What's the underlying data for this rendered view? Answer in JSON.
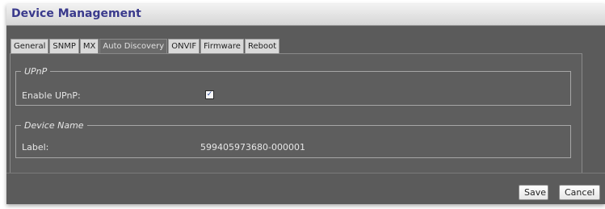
{
  "window": {
    "title": "Device Management"
  },
  "tabs": [
    {
      "label": "General",
      "active": false
    },
    {
      "label": "SNMP",
      "active": false
    },
    {
      "label": "MX",
      "active": false
    },
    {
      "label": "Auto Discovery",
      "active": true
    },
    {
      "label": "ONVIF",
      "active": false
    },
    {
      "label": "Firmware",
      "active": false
    },
    {
      "label": "Reboot",
      "active": false
    }
  ],
  "upnp": {
    "legend": "UPnP",
    "enable_label": "Enable UPnP:",
    "enabled": true,
    "check_glyph": "✓"
  },
  "device_name": {
    "legend": "Device Name",
    "label_text": "Label:",
    "label_value": "599405973680-000001"
  },
  "footer": {
    "save_label": "Save",
    "cancel_label": "Cancel"
  },
  "colors": {
    "title_text": "#3a3a8c",
    "panel_bg": "#5b5b5b",
    "active_tab_bg": "#6a6a6a"
  }
}
